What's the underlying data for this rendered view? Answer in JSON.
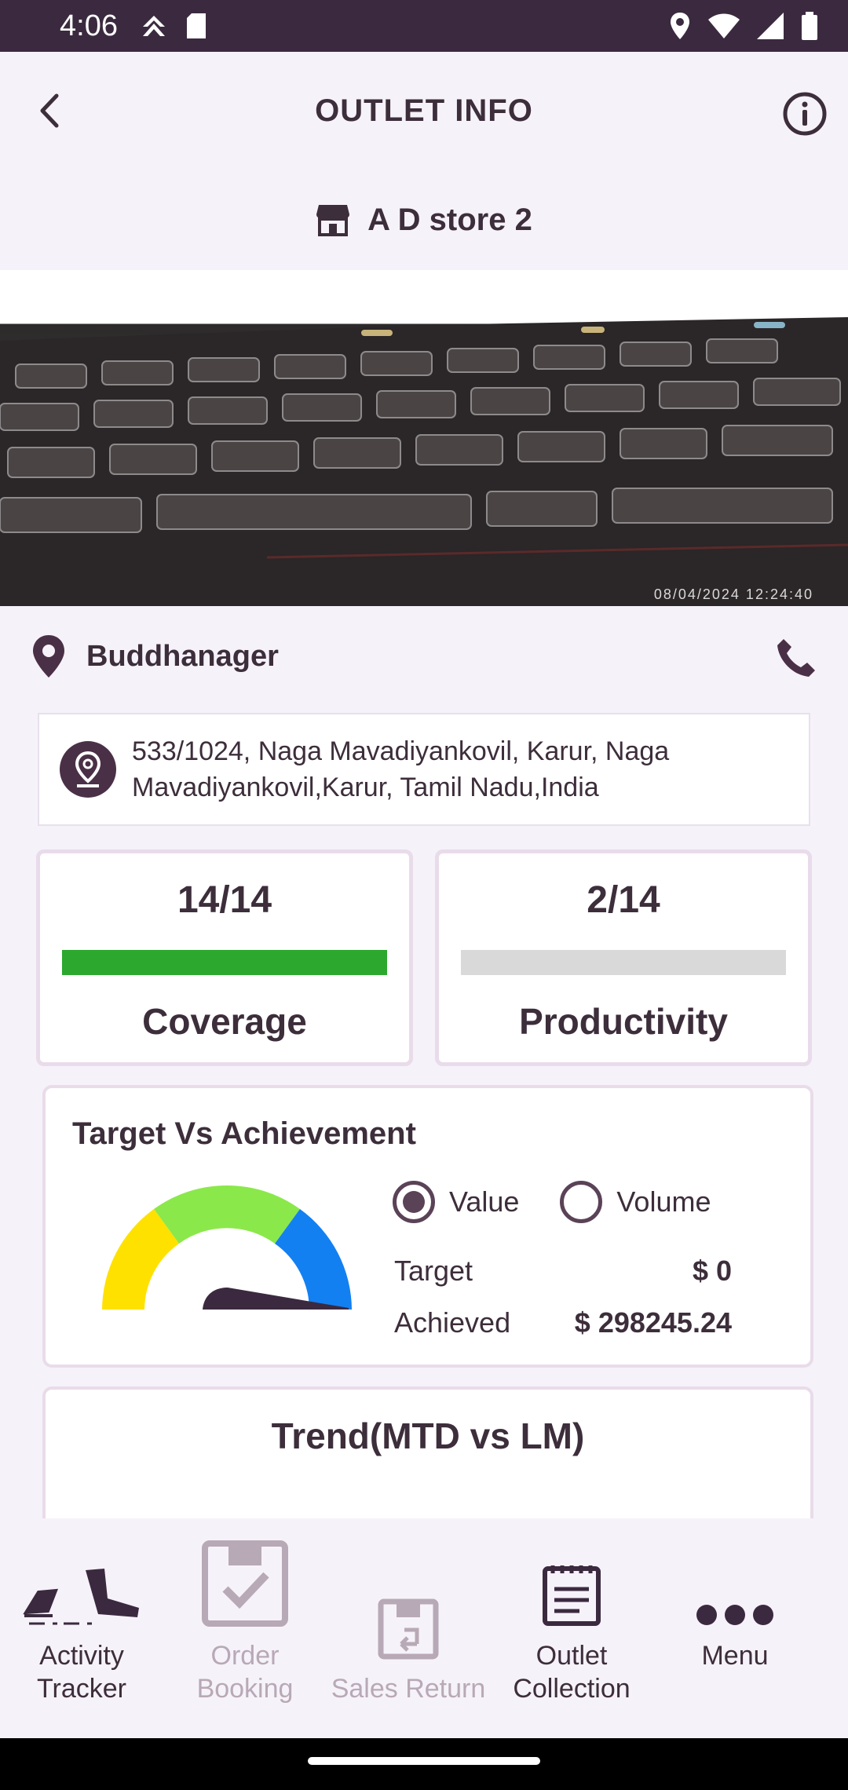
{
  "status_bar": {
    "time": "4:06"
  },
  "header": {
    "title": "OUTLET INFO"
  },
  "store": {
    "name": "A D store 2"
  },
  "photo": {
    "stamp": "08/04/2024 12:24:40"
  },
  "location": {
    "name": "Buddhanager",
    "address": "533/1024, Naga Mavadiyankovil, Karur, Naga Mavadiyankovil,Karur, Tamil Nadu,India"
  },
  "stats": {
    "coverage": {
      "value": "14/14",
      "label": "Coverage",
      "progress": 1.0
    },
    "productivity": {
      "value": "2/14",
      "label": "Productivity",
      "progress": 0.0
    }
  },
  "target_card": {
    "title": "Target Vs Achievement",
    "options": [
      {
        "label": "Value",
        "selected": true
      },
      {
        "label": "Volume",
        "selected": false
      }
    ],
    "target_label": "Target",
    "target_value": "$ 0",
    "achieved_label": "Achieved",
    "achieved_value": "$ 298245.24"
  },
  "trend_card": {
    "title": "Trend(MTD vs LM)"
  },
  "bottom_nav": [
    {
      "label_1": "Activity",
      "label_2": "Tracker",
      "icon": "footsteps-icon",
      "state": "active"
    },
    {
      "label_1": "Order",
      "label_2": "Booking",
      "icon": "checkbox-icon",
      "state": "disabled"
    },
    {
      "label_1": "Sales Return",
      "label_2": "",
      "icon": "return-box-icon",
      "state": "disabled"
    },
    {
      "label_1": "Outlet",
      "label_2": "Collection",
      "icon": "clipboard-icon",
      "state": "active"
    },
    {
      "label_1": "Menu",
      "label_2": "",
      "icon": "more-dots-icon",
      "state": "active"
    }
  ],
  "colors": {
    "primary": "#3b2a3f",
    "background": "#f6f2fa",
    "progress_green": "#2ca82e",
    "gauge_yellow": "#ffe100",
    "gauge_green": "#8be84a",
    "gauge_blue": "#1380f2"
  }
}
